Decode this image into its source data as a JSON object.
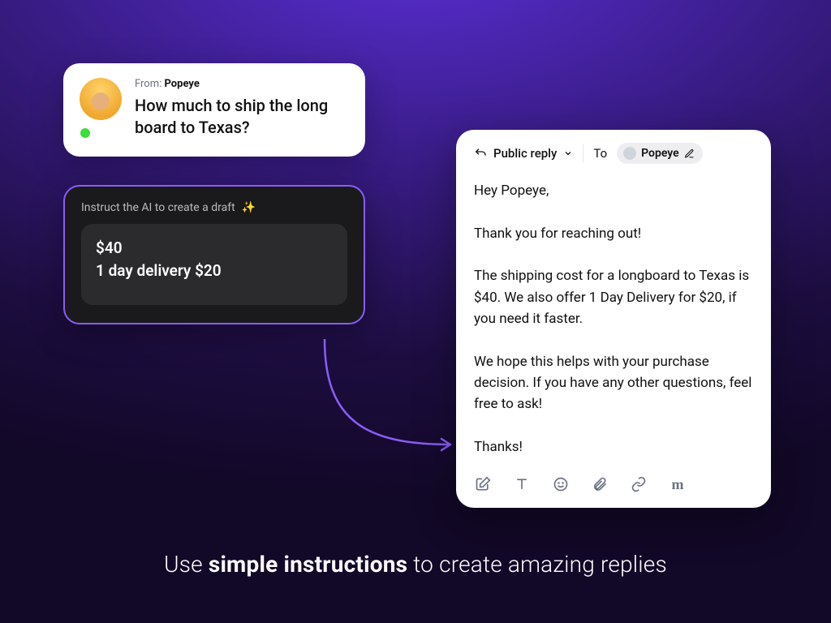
{
  "message": {
    "from_label": "From:",
    "from_name": "Popeye",
    "text": "How much to ship the long board to Texas?",
    "presence": "online"
  },
  "ai": {
    "label": "Instruct the AI to create a draft",
    "sparkle": "✨",
    "input_line1": "$40",
    "input_line2": "1 day delivery $20"
  },
  "reply": {
    "mode_label": "Public reply",
    "to_label": "To",
    "recipient": "Popeye",
    "body": "Hey Popeye,\n\nThank you for reaching out!\n\nThe shipping cost for a longboard to Texas is $40. We also offer 1 Day Delivery for $20, if you need it faster.\n\nWe hope this helps with your purchase decision. If you have any other questions, feel free to ask!\n\nThanks!"
  },
  "tagline": {
    "pre": "Use ",
    "highlight": "simple instructions",
    "post": " to create amazing replies"
  },
  "colors": {
    "accent": "#8b5cf6"
  }
}
